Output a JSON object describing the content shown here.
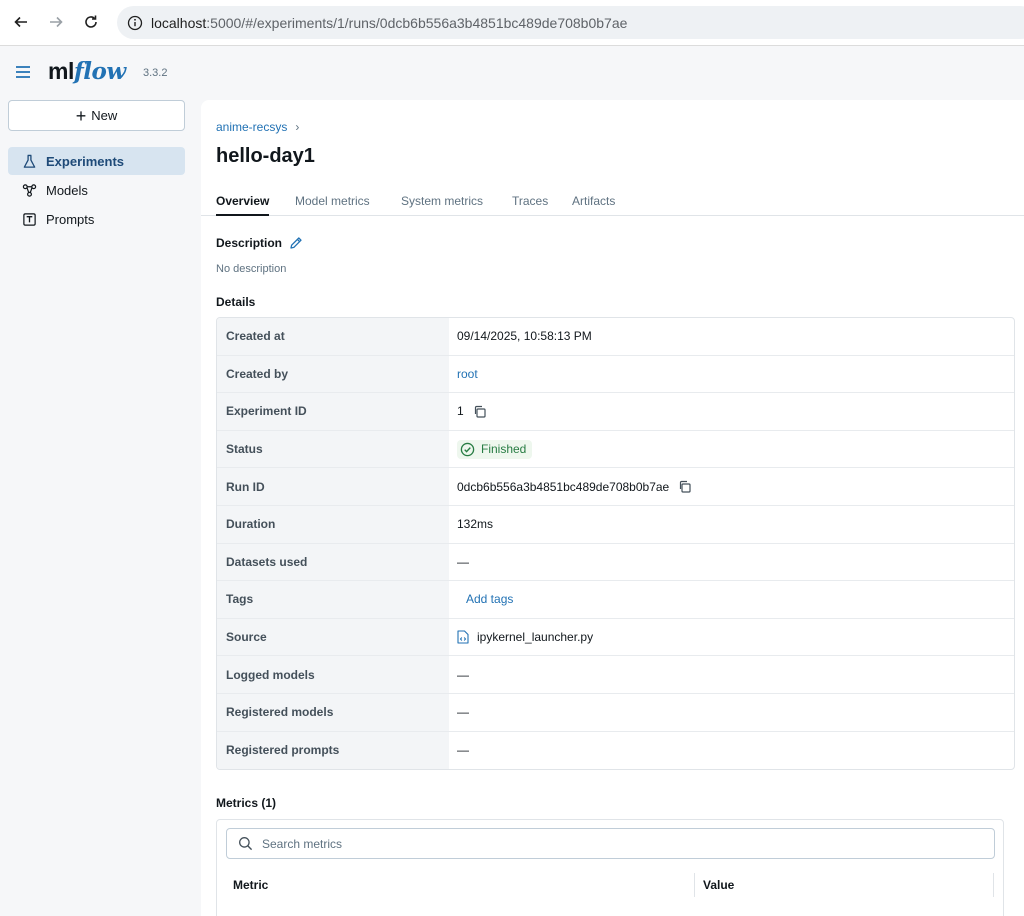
{
  "browser": {
    "url_host": "localhost",
    "url_rest": ":5000/#/experiments/1/runs/0dcb6b556a3b4851bc489de708b0b7ae"
  },
  "app": {
    "logo_ml": "ml",
    "logo_flow": "flow",
    "version": "3.3.2"
  },
  "sidebar": {
    "new_label": "New",
    "items": [
      {
        "label": "Experiments",
        "icon": "flask-icon",
        "active": true
      },
      {
        "label": "Models",
        "icon": "models-icon",
        "active": false
      },
      {
        "label": "Prompts",
        "icon": "prompts-icon",
        "active": false
      }
    ]
  },
  "breadcrumb": {
    "experiment": "anime-recsys",
    "separator": "›"
  },
  "page_title": "hello-day1",
  "tabs": [
    "Overview",
    "Model metrics",
    "System metrics",
    "Traces",
    "Artifacts"
  ],
  "description": {
    "label": "Description",
    "empty_text": "No description"
  },
  "details": {
    "label": "Details",
    "rows": {
      "created_at": {
        "key": "Created at",
        "value": "09/14/2025, 10:58:13 PM"
      },
      "created_by": {
        "key": "Created by",
        "value": "root"
      },
      "experiment_id": {
        "key": "Experiment ID",
        "value": "1"
      },
      "status": {
        "key": "Status",
        "value": "Finished"
      },
      "run_id": {
        "key": "Run ID",
        "value": "0dcb6b556a3b4851bc489de708b0b7ae"
      },
      "duration": {
        "key": "Duration",
        "value": "132ms"
      },
      "datasets_used": {
        "key": "Datasets used",
        "value": "—"
      },
      "tags": {
        "key": "Tags",
        "value": "Add tags"
      },
      "source": {
        "key": "Source",
        "value": "ipykernel_launcher.py"
      },
      "logged_models": {
        "key": "Logged models",
        "value": "—"
      },
      "registered_models": {
        "key": "Registered models",
        "value": "—"
      },
      "registered_prompts": {
        "key": "Registered prompts",
        "value": "—"
      }
    }
  },
  "metrics": {
    "label": "Metrics (1)",
    "search_placeholder": "Search metrics",
    "col_metric": "Metric",
    "col_value": "Value"
  },
  "colors": {
    "accent": "#2272b4",
    "success": "#277c43"
  }
}
